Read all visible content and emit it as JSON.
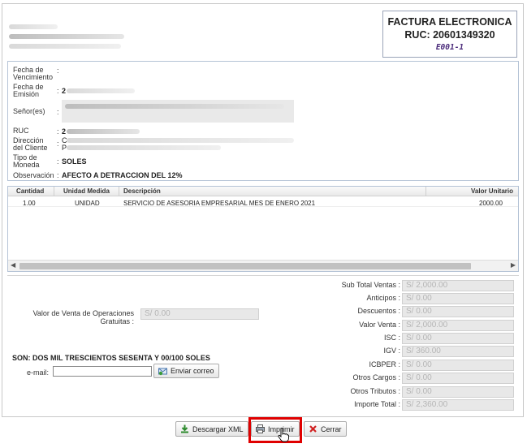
{
  "invoice": {
    "title": "FACTURA ELECTRONICA",
    "ruc": "RUC: 20601349320",
    "serie": "E001-1"
  },
  "client": {
    "vencimiento_label": "Fecha de Vencimiento",
    "emision_label": "Fecha de Emisión",
    "emision_value": "2",
    "senor_label": "Señor(es)",
    "ruc_label": "RUC",
    "ruc_value": "2",
    "direccion_label": "Dirección del Cliente",
    "direccion_value_1": "C",
    "direccion_value_2": "P",
    "moneda_label": "Tipo de Moneda",
    "moneda_value": "SOLES",
    "observacion_label": "Observación",
    "observacion_value": "AFECTO A DETRACCION DEL 12%"
  },
  "items": {
    "columns": [
      "Cantidad",
      "Unidad Medida",
      "Descripción",
      "Valor Unitario"
    ],
    "rows": [
      {
        "cantidad": "1.00",
        "unidad": "UNIDAD",
        "descripcion": "SERVICIO DE ASESORIA EMPRESARIAL MES DE ENERO 2021",
        "valor": "2000.00"
      }
    ]
  },
  "totals": {
    "gratuitas_label": "Valor de Venta de Operaciones Gratuitas :",
    "gratuitas_value": "S/ 0.00",
    "subtotal_label": "Sub Total Ventas :",
    "subtotal_value": "S/ 2,000.00",
    "anticipos_label": "Anticipos :",
    "anticipos_value": "S/ 0.00",
    "descuentos_label": "Descuentos :",
    "descuentos_value": "S/ 0.00",
    "valorventa_label": "Valor Venta :",
    "valorventa_value": "S/ 2,000.00",
    "isc_label": "ISC :",
    "isc_value": "S/ 0.00",
    "igv_label": "IGV :",
    "igv_value": "S/ 360.00",
    "icbper_label": "ICBPER :",
    "icbper_value": "S/ 0.00",
    "otroscargos_label": "Otros Cargos :",
    "otroscargos_value": "S/ 0.00",
    "otrostributos_label": "Otros Tributos :",
    "otrostributos_value": "S/ 0.00",
    "importe_label": "Importe Total :",
    "importe_value": "S/ 2,360.00"
  },
  "son": "SON: DOS MIL TRESCIENTOS SESENTA Y 00/100 SOLES",
  "email": {
    "label": "e-mail:",
    "value": "",
    "send_label": "Enviar correo"
  },
  "actions": {
    "xml_label": "Descargar XML",
    "print_label": "Imprimir",
    "close_label": "Cerrar"
  }
}
